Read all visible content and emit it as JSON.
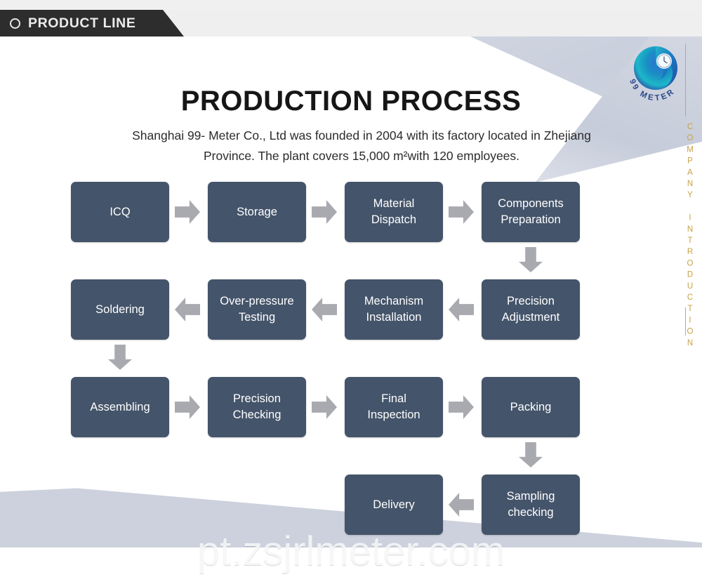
{
  "topbar": {
    "icon": "circle-icon",
    "label": "PRODUCT LINE"
  },
  "brand": {
    "logo_name": "99-meter-swirl-logo",
    "logo_text": "99 METER",
    "vertical_label": "COMPANY INTRODUCTION",
    "gold_color": "#c6a245"
  },
  "header": {
    "title": "PRODUCTION PROCESS",
    "subtitle": "Shanghai 99- Meter Co., Ltd was founded in 2004 with its factory located in Zhejiang Province. The plant covers 15,000 m²with 120 employees."
  },
  "colors": {
    "box_fill": "#44546a",
    "box_text": "#ffffff",
    "arrow_fill": "#a9aab0",
    "banner_dark": "#2d2d2d",
    "decor_blue_grey": "#ccd1dd"
  },
  "flow": {
    "rows": [
      {
        "direction": "right",
        "steps": [
          "ICQ",
          "Storage",
          "Material Dispatch",
          "Components Preparation"
        ]
      },
      {
        "direction": "left",
        "steps": [
          "Soldering",
          "Over-pressure Testing",
          "Mechanism Installation",
          "Precision Adjustment"
        ]
      },
      {
        "direction": "right",
        "steps": [
          "Assembling",
          "Precision Checking",
          "Final Inspection",
          "Packing"
        ]
      },
      {
        "direction": "left",
        "steps": [
          "Delivery",
          "Sampling checking"
        ]
      }
    ],
    "boxes": {
      "r1c1": "ICQ",
      "r1c2": "Storage",
      "r1c3_line1": "Material",
      "r1c3_line2": "Dispatch",
      "r1c4_line1": "Components",
      "r1c4_line2": "Preparation",
      "r2c1": "Soldering",
      "r2c2_line1": "Over-pressure",
      "r2c2_line2": "Testing",
      "r2c3_line1": "Mechanism",
      "r2c3_line2": "Installation",
      "r2c4_line1": "Precision",
      "r2c4_line2": "Adjustment",
      "r3c1": "Assembling",
      "r3c2_line1": "Precision",
      "r3c2_line2": "Checking",
      "r3c3_line1": "Final",
      "r3c3_line2": "Inspection",
      "r3c4": "Packing",
      "r4c3": "Delivery",
      "r4c4_line1": "Sampling",
      "r4c4_line2": "checking"
    }
  },
  "watermark": {
    "text": "pt.zsjrlmeter.com"
  }
}
